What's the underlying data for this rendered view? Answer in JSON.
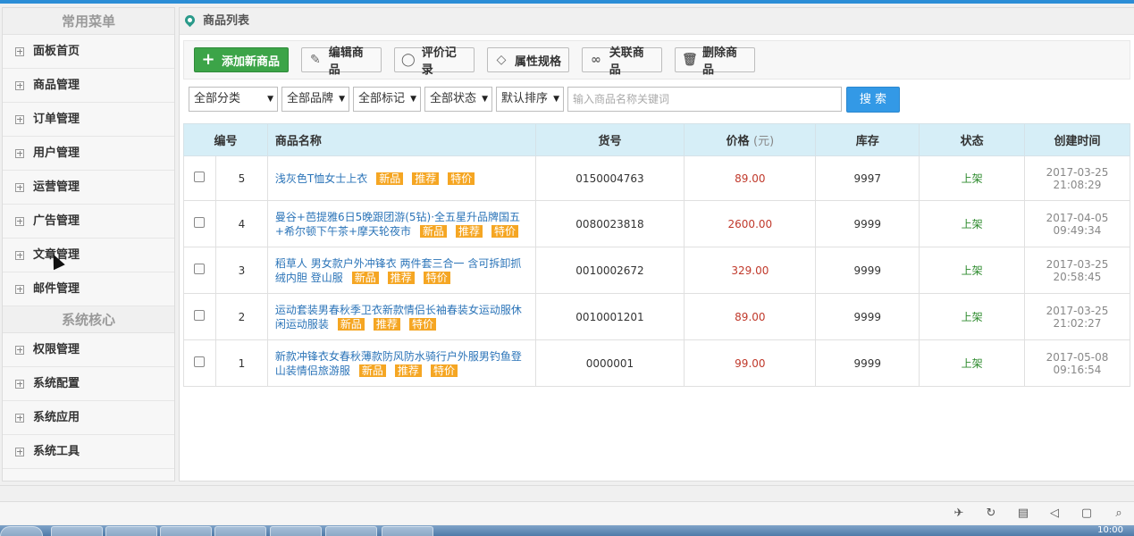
{
  "sidebar": {
    "group1_title": "常用菜单",
    "group1_items": [
      "面板首页",
      "商品管理",
      "订单管理",
      "用户管理",
      "运营管理",
      "广告管理",
      "文章管理",
      "邮件管理"
    ],
    "group2_title": "系统核心",
    "group2_items": [
      "权限管理",
      "系统配置",
      "系统应用",
      "系统工具"
    ]
  },
  "breadcrumb": {
    "title": "商品列表"
  },
  "toolbar": {
    "add": "添加新商品",
    "edit": "编辑商品",
    "reviews": "评价记录",
    "attrs": "属性规格",
    "related": "关联商品",
    "delete": "删除商品"
  },
  "filters": {
    "category": "全部分类",
    "brand": "全部品牌",
    "mark": "全部标记",
    "status": "全部状态",
    "sort": "默认排序",
    "search_placeholder": "输入商品名称关键词",
    "search_button": "搜 索"
  },
  "table": {
    "headers": {
      "id": "编号",
      "name": "商品名称",
      "sku": "货号",
      "price": "价格",
      "price_unit": "(元)",
      "stock": "库存",
      "status": "状态",
      "created": "创建时间"
    },
    "tags": {
      "new": "新品",
      "recommend": "推荐",
      "special": "特价"
    },
    "rows": [
      {
        "id": "5",
        "name": "浅灰色T恤女士上衣",
        "sku": "0150004763",
        "price": "89.00",
        "stock": "9997",
        "status": "上架",
        "date": "2017-03-25",
        "time": "21:08:29"
      },
      {
        "id": "4",
        "name": "曼谷+芭提雅6日5晚跟团游(5钻)·全五星升品牌国五+希尔顿下午茶+摩天轮夜市",
        "sku": "0080023818",
        "price": "2600.00",
        "stock": "9999",
        "status": "上架",
        "date": "2017-04-05",
        "time": "09:49:34"
      },
      {
        "id": "3",
        "name": "稻草人 男女款户外冲锋衣 两件套三合一 含可拆卸抓绒内胆 登山服",
        "sku": "0010002672",
        "price": "329.00",
        "stock": "9999",
        "status": "上架",
        "date": "2017-03-25",
        "time": "20:58:45"
      },
      {
        "id": "2",
        "name": "运动套装男春秋季卫衣新款情侣长袖春装女运动服休闲运动服装",
        "sku": "0010001201",
        "price": "89.00",
        "stock": "9999",
        "status": "上架",
        "date": "2017-03-25",
        "time": "21:02:27"
      },
      {
        "id": "1",
        "name": "新款冲锋衣女春秋薄款防风防水骑行户外服男钓鱼登山装情侣旅游服",
        "sku": "0000001",
        "price": "99.00",
        "stock": "9999",
        "status": "上架",
        "date": "2017-05-08",
        "time": "09:16:54"
      }
    ]
  },
  "taskbar": {
    "clock": "10:00"
  }
}
